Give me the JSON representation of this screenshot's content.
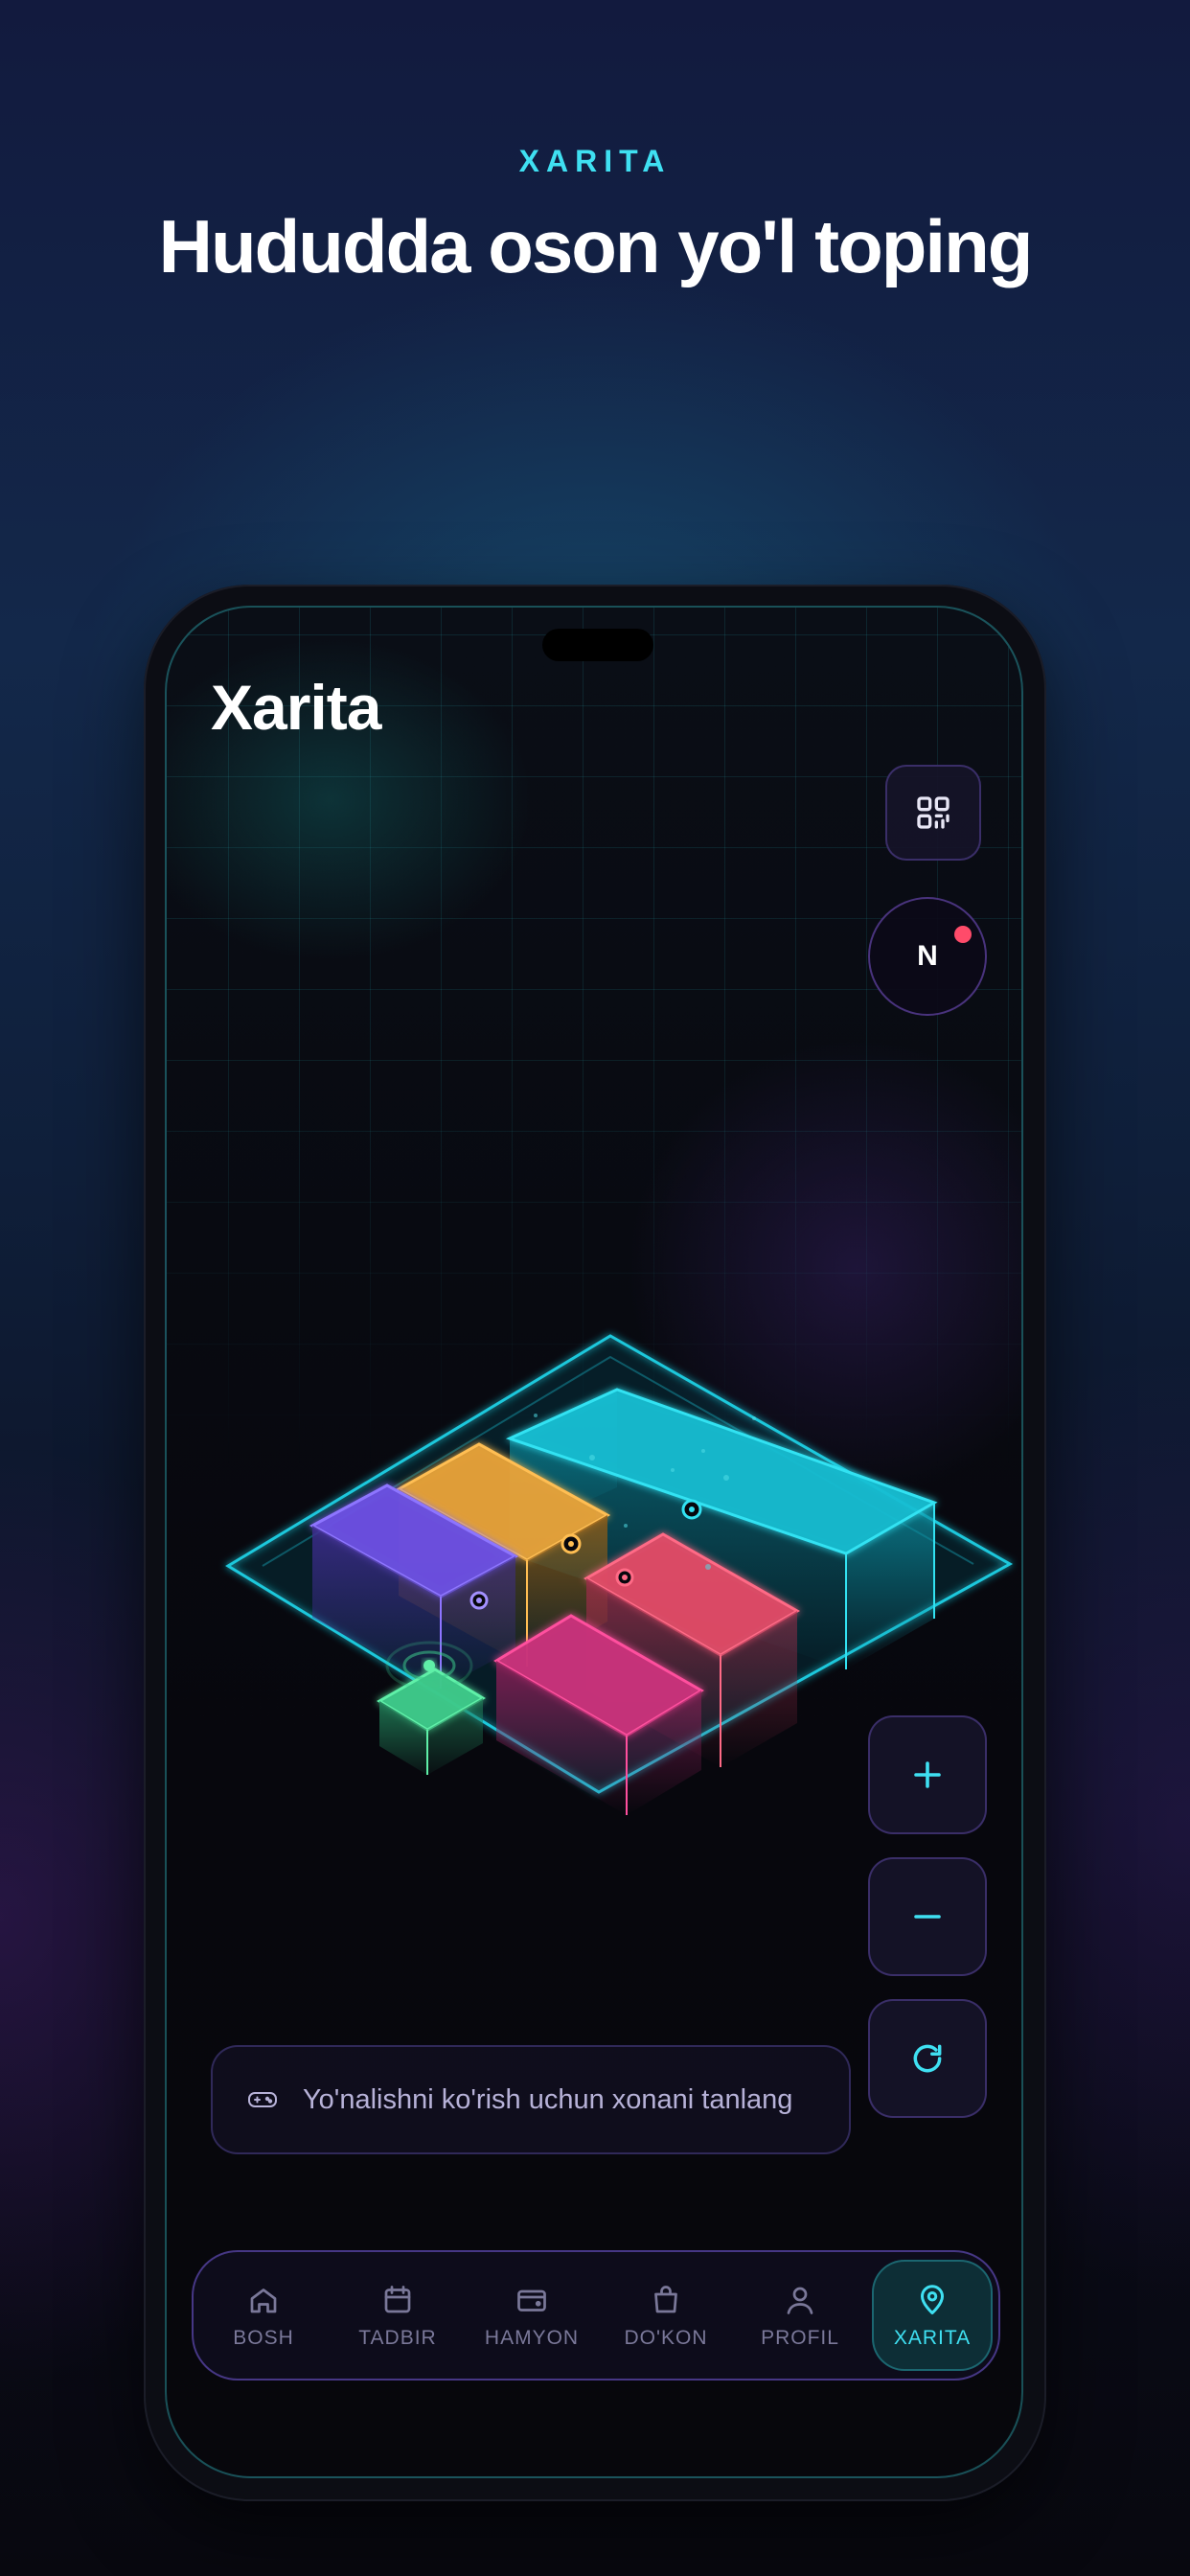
{
  "header": {
    "eyebrow": "XARITA",
    "headline": "Hududda oson yo'l toping"
  },
  "screen": {
    "title": "Xarita",
    "compass_label": "N",
    "hint_text": "Yo'nalishni ko'rish uchun xonani tanlang",
    "icons": {
      "qr": "qr-scan-icon",
      "zoom_in": "plus-icon",
      "zoom_out": "minus-icon",
      "reset": "refresh-icon",
      "hint": "gamepad-icon"
    },
    "colors": {
      "accent": "#3fe0f2",
      "compass_dot": "#ff4b6a",
      "room_cyan": "#1ec8dc",
      "room_orange": "#e9a33a",
      "room_purple": "#6b4fe0",
      "room_red": "#e04a66",
      "room_magenta": "#c8327a",
      "room_green": "#3dc98a"
    }
  },
  "tabbar": {
    "tabs": [
      {
        "label": "BOSH",
        "icon": "home-icon",
        "active": false
      },
      {
        "label": "TADBIR",
        "icon": "calendar-icon",
        "active": false
      },
      {
        "label": "HAMYON",
        "icon": "wallet-icon",
        "active": false
      },
      {
        "label": "DO'KON",
        "icon": "shopping-bag-icon",
        "active": false
      },
      {
        "label": "PROFIL",
        "icon": "user-icon",
        "active": false
      },
      {
        "label": "XARITA",
        "icon": "map-pin-icon",
        "active": true
      }
    ]
  }
}
